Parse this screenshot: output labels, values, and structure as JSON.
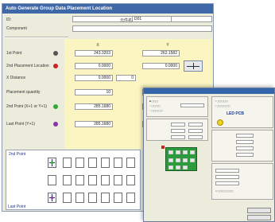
{
  "window": {
    "title": "Auto Generate Group Data Placement Location"
  },
  "header_fields": {
    "id_label": "ID:",
    "component_label": "Component",
    "cn_label": "元件名",
    "cn_value": "D01"
  },
  "columns": {
    "x": "X",
    "y": "Y"
  },
  "rows": [
    {
      "label": "1st Point",
      "dot_color": "#555555",
      "x": "243.3203",
      "y": "262.1582"
    },
    {
      "label": "2nd Placement Location",
      "dot_color": "#cc2222",
      "x": "0.0000",
      "y": "0.0000"
    },
    {
      "label": "X Distance",
      "x": "0.0000",
      "extra": "0"
    },
    {
      "label": "Placement quantity",
      "x": "10"
    },
    {
      "label": "2nd Point (X+1 or Y+1)",
      "dot_color": "#33aa33",
      "x": "285.1680"
    },
    {
      "label": "Last Point (Y+1)",
      "dot_color": "#8833aa",
      "x": "285.1680"
    }
  ],
  "preview": {
    "second_point_label": "2nd Point",
    "last_point_label": "Last Point"
  },
  "overlay": {
    "led_pcb_label": "LED PCB"
  },
  "colors": {
    "title_bar": "#3f68a8",
    "dialog_bg": "#ececdc",
    "highlight_zone": "#fbf5c2",
    "pcb_green": "#2e9a3e"
  }
}
